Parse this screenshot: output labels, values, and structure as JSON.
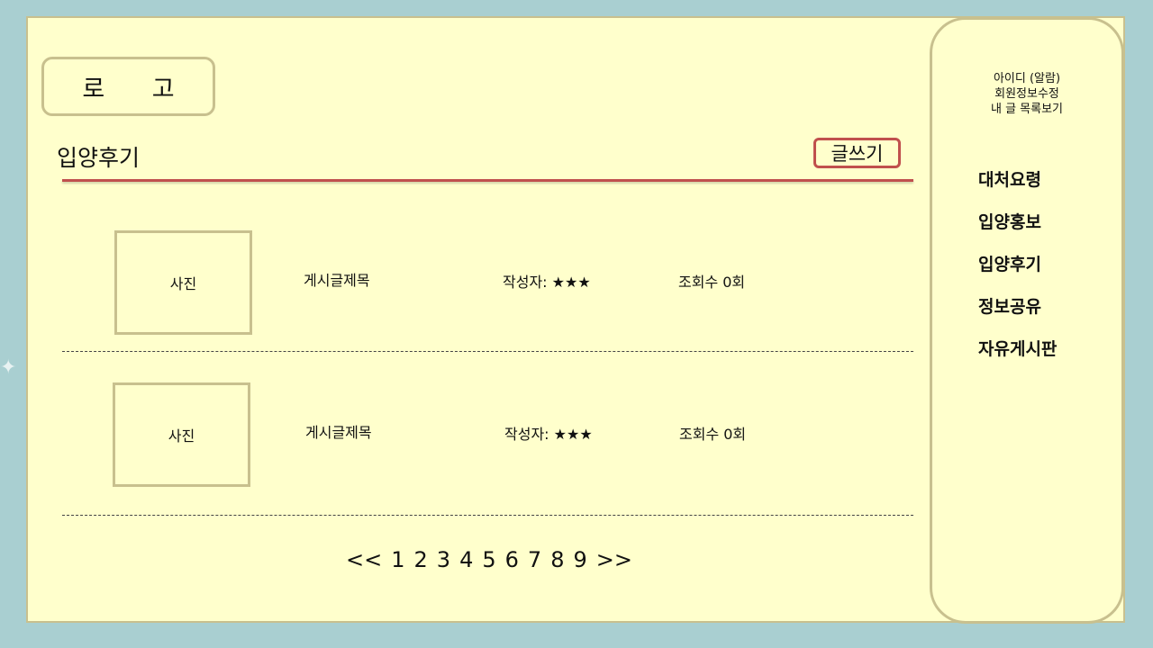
{
  "header": {
    "logo": "로 고",
    "page_title": "입양후기",
    "write_button": "글쓰기"
  },
  "posts": [
    {
      "photo": "사진",
      "title": "게시글제목",
      "author": "작성자: ★★★",
      "views": "조회수 0회"
    },
    {
      "photo": "사진",
      "title": "게시글제목",
      "author": "작성자: ★★★",
      "views": "조회수 0회"
    }
  ],
  "pagination": {
    "prev": "<<",
    "pages": [
      "1",
      "2",
      "3",
      "4",
      "5",
      "6",
      "7",
      "8",
      "9"
    ],
    "next": ">>"
  },
  "sidebar": {
    "user_links": [
      "아이디 (알람)",
      "회원정보수정",
      "내 글 목록보기"
    ],
    "nav": [
      "대처요령",
      "입양홍보",
      "입양후기",
      "정보공유",
      "자유게시판"
    ]
  },
  "colors": {
    "background": "#a9cfd1",
    "canvas": "#ffffcc",
    "border": "#c8c08e",
    "accent": "#c0504d"
  }
}
